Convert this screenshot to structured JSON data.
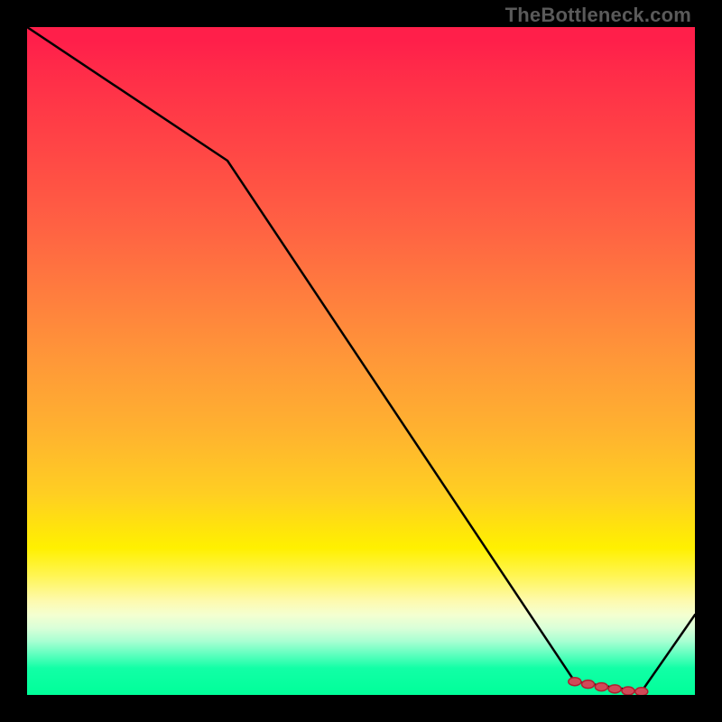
{
  "watermark": "TheBottleneck.com",
  "colors": {
    "line": "#000000",
    "marker_stroke": "#b02030",
    "marker_fill": "#d04a58"
  },
  "chart_data": {
    "type": "line",
    "title": "",
    "xlabel": "",
    "ylabel": "",
    "xlim": [
      0,
      100
    ],
    "ylim": [
      0,
      100
    ],
    "x": [
      0,
      30,
      82,
      92,
      100
    ],
    "y": [
      100,
      80,
      2,
      0.5,
      12
    ],
    "markers": [
      {
        "x": 82,
        "y": 2
      },
      {
        "x": 84,
        "y": 1.6
      },
      {
        "x": 86,
        "y": 1.2
      },
      {
        "x": 88,
        "y": 0.9
      },
      {
        "x": 90,
        "y": 0.6
      },
      {
        "x": 92,
        "y": 0.5
      }
    ]
  }
}
